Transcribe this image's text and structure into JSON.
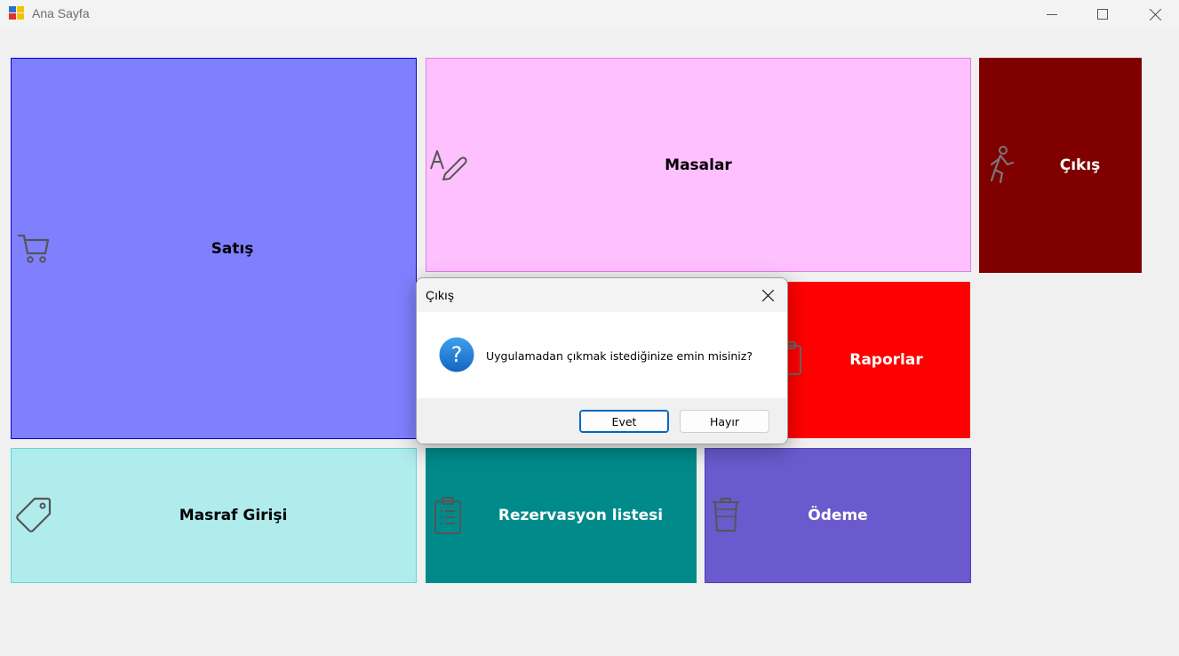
{
  "window": {
    "title": "Ana Sayfa"
  },
  "tiles": {
    "satis": {
      "label": "Satış",
      "icon": "cart-icon",
      "bg": "#8080ff",
      "border": "#0000c0",
      "text_color": "#000000"
    },
    "masalar": {
      "label": "Masalar",
      "icon": "text-pen-icon",
      "bg": "#ffc0ff",
      "border": "#e87ff0",
      "text_color": "#000000"
    },
    "cikis": {
      "label": "Çıkış",
      "icon": "running-person-icon",
      "bg": "#800000",
      "text_color": "#ffffff"
    },
    "raporlar": {
      "label": "Raporlar",
      "icon": "clipboard-icon",
      "bg": "#ff0000",
      "text_color": "#ffffff"
    },
    "masraf": {
      "label": "Masraf Girişi",
      "icon": "tag-icon",
      "bg": "#b0ecec",
      "border": "#60d8d8",
      "text_color": "#000000"
    },
    "rezervasyon": {
      "label": "Rezervasyon listesi",
      "icon": "clipboard-list-icon",
      "bg": "#008a8a",
      "text_color": "#ffffff"
    },
    "odeme": {
      "label": "Ödeme",
      "icon": "trash-icon",
      "bg": "#6a5acd",
      "text_color": "#ffffff"
    }
  },
  "dialog": {
    "title": "Çıkış",
    "message": "Uygulamadan çıkmak istediğinize emin misiniz?",
    "icon": "question-icon",
    "yes_label": "Evet",
    "no_label": "Hayır"
  }
}
